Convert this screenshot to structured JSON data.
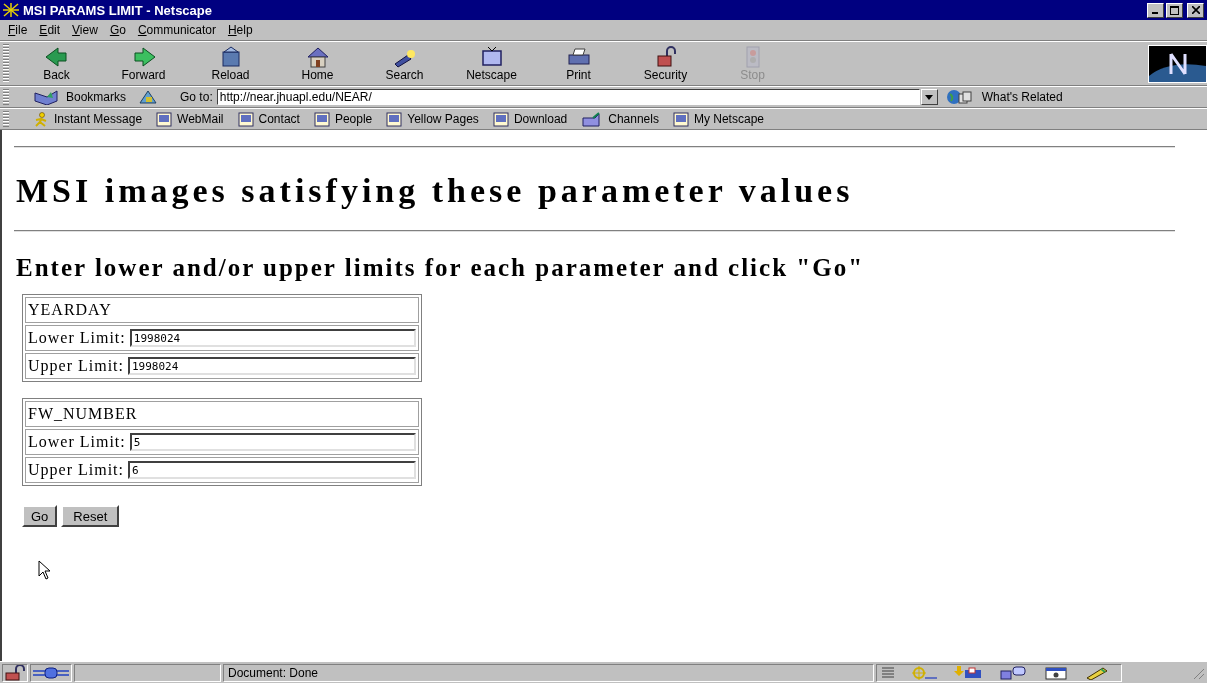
{
  "window": {
    "title": "MSI PARAMS LIMIT - Netscape"
  },
  "menu": [
    {
      "label": "File"
    },
    {
      "label": "Edit"
    },
    {
      "label": "View"
    },
    {
      "label": "Go"
    },
    {
      "label": "Communicator"
    },
    {
      "label": "Help"
    }
  ],
  "toolbar": [
    {
      "label": "Back",
      "kind": "back",
      "disabled": false
    },
    {
      "label": "Forward",
      "kind": "forward",
      "disabled": false
    },
    {
      "label": "Reload",
      "kind": "reload",
      "disabled": false
    },
    {
      "label": "Home",
      "kind": "home",
      "disabled": false
    },
    {
      "label": "Search",
      "kind": "search",
      "disabled": false
    },
    {
      "label": "Netscape",
      "kind": "netscape",
      "disabled": false
    },
    {
      "label": "Print",
      "kind": "print",
      "disabled": false
    },
    {
      "label": "Security",
      "kind": "security",
      "disabled": false
    },
    {
      "label": "Stop",
      "kind": "stop",
      "disabled": true
    }
  ],
  "location": {
    "bookmarks_label": "Bookmarks",
    "goto_label": "Go to:",
    "url": "http://near.jhuapl.edu/NEAR/",
    "related_label": "What's Related"
  },
  "personal_toolbar": [
    {
      "label": "Instant Message",
      "kind": "messenger"
    },
    {
      "label": "WebMail",
      "kind": "page"
    },
    {
      "label": "Contact",
      "kind": "page"
    },
    {
      "label": "People",
      "kind": "page"
    },
    {
      "label": "Yellow Pages",
      "kind": "page"
    },
    {
      "label": "Download",
      "kind": "page"
    },
    {
      "label": "Channels",
      "kind": "channels"
    },
    {
      "label": "My Netscape",
      "kind": "page"
    }
  ],
  "page": {
    "heading": "MSI images satisfying these parameter values",
    "subheading": "Enter lower and/or upper limits for each parameter and click \"Go\"",
    "parameters": [
      {
        "name": "YEARDAY",
        "fields": [
          {
            "label": "Lower Limit:",
            "value": "1998024"
          },
          {
            "label": "Upper Limit:",
            "value": "1998024"
          }
        ]
      },
      {
        "name": "FW_NUMBER",
        "fields": [
          {
            "label": "Lower Limit:",
            "value": "5"
          },
          {
            "label": "Upper Limit:",
            "value": "6"
          }
        ]
      }
    ],
    "buttons": [
      {
        "label": "Go"
      },
      {
        "label": "Reset"
      }
    ]
  },
  "status_bar": {
    "text": "Document: Done"
  }
}
